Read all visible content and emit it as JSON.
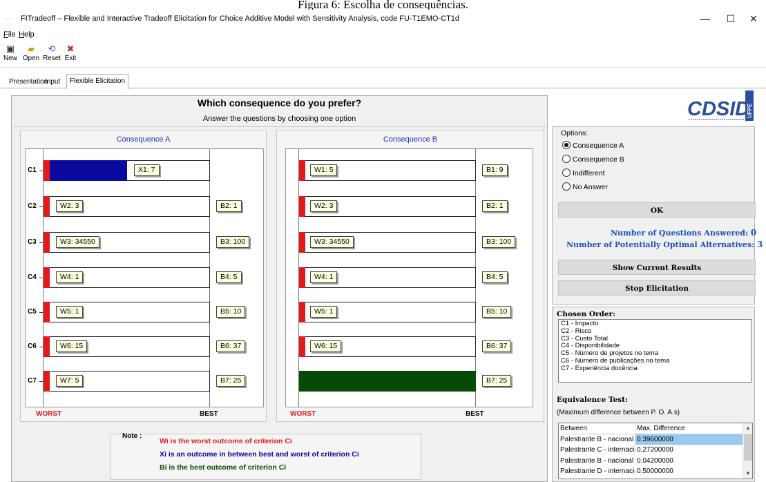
{
  "caption": "Figura 6: Escolha de consequências.",
  "window": {
    "icon": "·····",
    "title": "FITradeoff – Flexible and Interactive Tradeoff Elicitation for Choice Additive Model with Sensitivity Analysis, code FU-T1EMO-CT1d",
    "minimize": "—",
    "maximize": "☐",
    "close": "✕"
  },
  "menu": [
    {
      "key": "F",
      "rest": "ile"
    },
    {
      "key": "H",
      "rest": "elp"
    }
  ],
  "toolbar": [
    {
      "label": "New",
      "icon": "save-icon",
      "glyph": "▣",
      "color": "#333333"
    },
    {
      "label": "Open",
      "icon": "folder-icon",
      "glyph": "▰",
      "color": "#c8a000"
    },
    {
      "label": "Reset",
      "icon": "refresh-icon",
      "glyph": "⟲",
      "color": "#1f56c8"
    },
    {
      "label": "Exit",
      "icon": "exit-icon",
      "glyph": "✖",
      "color": "#c0392b"
    }
  ],
  "tabs": [
    {
      "label": "Presentation",
      "active": false
    },
    {
      "label": "Input",
      "active": false
    },
    {
      "label": "Flexible Elicitation",
      "active": true
    }
  ],
  "question": {
    "title": "Which consequence do you prefer?",
    "subtitle": "Answer the questions by choosing one option"
  },
  "colors": {
    "worst": "#e21a1a",
    "between": "#0a0aa0",
    "best": "#054a05",
    "accent": "#1a4fb8"
  },
  "consequence_a": {
    "title": "Consequence A",
    "rows": [
      {
        "crit": "C1",
        "left": "X1: 7",
        "right": "",
        "fill": "blue",
        "fill_fraction": 0.5
      },
      {
        "crit": "C2",
        "left": "W2: 3",
        "right": "B2: 1",
        "fill": "none"
      },
      {
        "crit": "C3",
        "left": "W3: 34550",
        "right": "B3: 100",
        "fill": "none"
      },
      {
        "crit": "C4",
        "left": "W4: 1",
        "right": "B4: 5",
        "fill": "none"
      },
      {
        "crit": "C5",
        "left": "W5: 1",
        "right": "B5: 10",
        "fill": "none"
      },
      {
        "crit": "C6",
        "left": "W6: 15",
        "right": "B6: 37",
        "fill": "none"
      },
      {
        "crit": "C7",
        "left": "W7: 5",
        "right": "B7: 25",
        "fill": "none"
      }
    ]
  },
  "consequence_b": {
    "title": "Consequence B",
    "rows": [
      {
        "crit": "C1",
        "left": "W1: 5",
        "right": "B1: 9",
        "fill": "none"
      },
      {
        "crit": "C2",
        "left": "W2: 3",
        "right": "B2: 1",
        "fill": "none"
      },
      {
        "crit": "C3",
        "left": "W3: 34550",
        "right": "B3: 100",
        "fill": "none"
      },
      {
        "crit": "C4",
        "left": "W4: 1",
        "right": "B4: 5",
        "fill": "none"
      },
      {
        "crit": "C5",
        "left": "W5: 1",
        "right": "B5: 10",
        "fill": "none"
      },
      {
        "crit": "C6",
        "left": "W6: 15",
        "right": "B6: 37",
        "fill": "none"
      },
      {
        "crit": "C7",
        "left": "",
        "right": "B7: 25",
        "fill": "green",
        "fill_fraction": 1.0
      }
    ]
  },
  "axis": {
    "worst": "WORST",
    "best": "BEST"
  },
  "note": {
    "head": "Note :",
    "lines": [
      {
        "text": "Wi is the worst outcome of criterion Ci",
        "color": "#e21a1a"
      },
      {
        "text": "Xi is an outcome in between best and worst of criterion Ci",
        "color": "#0a0aa0"
      },
      {
        "text": "Bi is the best outcome of criterion Ci",
        "color": "#054a05"
      }
    ]
  },
  "logo": {
    "text": "CDSID",
    "side": "UFPE"
  },
  "options": {
    "head": "Options:",
    "items": [
      {
        "label": "Consequence A",
        "checked": true
      },
      {
        "label": "Consequence B",
        "checked": false
      },
      {
        "label": "Indifferent",
        "checked": false
      },
      {
        "label": "No Answer",
        "checked": false
      }
    ],
    "ok": "OK"
  },
  "stats": {
    "answered_label": "Number of Questions Answered:",
    "answered_value": "0",
    "optimal_label": "Number of Potentially Optimal Alternatives:",
    "optimal_value": "3"
  },
  "buttons": {
    "show_results": "Show Current Results",
    "stop": "Stop Elicitation"
  },
  "chosen_order": {
    "head": "Chosen Order:",
    "items": [
      "C1 - Impacto",
      "C2 - Risco",
      "C3 - Custo Total",
      "C4 - Disponibilidade",
      "C5 - Número de projetos no tema",
      "C6 - Número de publicações no tema",
      "C7 - Experiência docência"
    ]
  },
  "equivalence": {
    "head": "Equivalence Test:",
    "sub": "(Maximum difference between P. O. A.s)",
    "columns": [
      "Between",
      "Max. Difference"
    ],
    "rows": [
      {
        "between": "Palestrante B - nacional - Pa",
        "diff": "0.39600000",
        "selected": true
      },
      {
        "between": "Palestrante C - internaciona",
        "diff": "0.27200000",
        "selected": false
      },
      {
        "between": "Palestrante B - nacional - Pa",
        "diff": "0.04200000",
        "selected": false
      },
      {
        "between": "Palestrante D - internaciona",
        "diff": "0.50000000",
        "selected": false
      }
    ]
  }
}
